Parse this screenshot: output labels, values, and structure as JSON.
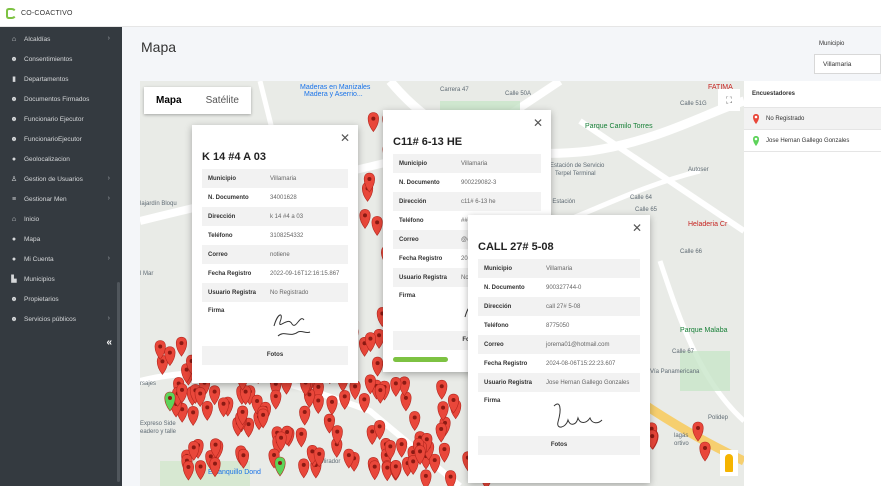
{
  "brand": {
    "name": "CO-COACTIVO"
  },
  "sidebar": {
    "items": [
      {
        "label": "Alcaldías",
        "icon": "bank-icon",
        "chevron": true
      },
      {
        "label": "Consentimientos",
        "icon": "users-icon",
        "chevron": false
      },
      {
        "label": "Departamentos",
        "icon": "building-icon",
        "chevron": false
      },
      {
        "label": "Documentos Firmados",
        "icon": "users-icon",
        "chevron": false
      },
      {
        "label": "Funcionario Ejecutor",
        "icon": "users-icon",
        "chevron": false
      },
      {
        "label": "FuncionarioEjecutor",
        "icon": "users-icon",
        "chevron": false
      },
      {
        "label": "Geolocalizacion",
        "icon": "map-marker-icon",
        "chevron": false
      },
      {
        "label": "Gestion de Usuarios",
        "icon": "user-icon",
        "chevron": true
      },
      {
        "label": "Gestionar Men",
        "icon": "list-icon",
        "chevron": true
      },
      {
        "label": "Inicio",
        "icon": "home-icon",
        "chevron": false
      },
      {
        "label": "Mapa",
        "icon": "map-marker-icon",
        "chevron": false
      },
      {
        "label": "Mi Cuenta",
        "icon": "circle-icon",
        "chevron": true
      },
      {
        "label": "Municipios",
        "icon": "industry-icon",
        "chevron": false
      },
      {
        "label": "Propietarios",
        "icon": "users-icon",
        "chevron": false
      },
      {
        "label": "Servicios públicos",
        "icon": "users-icon",
        "chevron": true
      }
    ],
    "collapse_label": "«"
  },
  "page": {
    "title": "Mapa"
  },
  "filter": {
    "label": "Municipio",
    "value": "Villamaria"
  },
  "map": {
    "type_buttons": {
      "map": "Mapa",
      "satellite": "Satélite"
    },
    "labels": [
      "Maderas en Manizales",
      "Madera y Aserrio...",
      "Carrera 47",
      "Calle 50A",
      "Calle 51G",
      "Parque Camilo Torres",
      "Estación de Servicio",
      "Terpel Terminal",
      "reo Estación",
      "Autoser",
      "Heladeria Cr",
      "Calle 64",
      "Calle 65",
      "Calle 66",
      "Parque Malaba",
      "Calle 67",
      "Vía Panamericana",
      "lajardín Bloqu",
      "l Mar",
      "rsajes",
      "Expreso Side",
      "eadero y talle",
      "Estanquillo Dond",
      "Mirador",
      "tronger Gym",
      "lagás",
      "ortivo",
      "Polidep",
      "FATIMA"
    ]
  },
  "popups": [
    {
      "title": "K 14 #4 A 03",
      "rows": [
        {
          "k": "Municipio",
          "v": "Villamaria"
        },
        {
          "k": "N. Documento",
          "v": "34001628"
        },
        {
          "k": "Dirección",
          "v": "k 14 #4 a 03"
        },
        {
          "k": "Teléfono",
          "v": "3108254332"
        },
        {
          "k": "Correo",
          "v": "notiene"
        },
        {
          "k": "Fecha Registro",
          "v": "2022-09-16T12:16:15.867"
        },
        {
          "k": "Usuario Registra",
          "v": "No Registrado"
        }
      ],
      "sig_label": "Firma",
      "fotos": "Fotos"
    },
    {
      "title": "C11# 6-13 HE",
      "rows": [
        {
          "k": "Municipio",
          "v": "Villamaria"
        },
        {
          "k": "N. Documento",
          "v": "900229082-3"
        },
        {
          "k": "Dirección",
          "v": "c11# 6-13 he"
        },
        {
          "k": "Teléfono",
          "v": "###"
        },
        {
          "k": "Correo",
          "v": "@@"
        },
        {
          "k": "Fecha Registro",
          "v": "202"
        },
        {
          "k": "Usuario Registra",
          "v": "No"
        }
      ],
      "sig_label": "Firma",
      "fotos": "Fot"
    },
    {
      "title": "CALL 27# 5-08",
      "rows": [
        {
          "k": "Municipio",
          "v": "Villamaria"
        },
        {
          "k": "N. Documento",
          "v": "900327744-0"
        },
        {
          "k": "Dirección",
          "v": "call 27# 5-08"
        },
        {
          "k": "Teléfono",
          "v": "8775050"
        },
        {
          "k": "Correo",
          "v": "jorema01@hotmail.com"
        },
        {
          "k": "Fecha Registro",
          "v": "2024-08-06T15:22:23.607"
        },
        {
          "k": "Usuario Registra",
          "v": "Jose Hernan Gallego Gonzales"
        }
      ],
      "sig_label": "Firma",
      "fotos": "Fotos"
    }
  ],
  "legend": {
    "title": "Encuestadores",
    "items": [
      {
        "label": "No Registrado",
        "color": "#e9473a"
      },
      {
        "label": "Jose Hernan Gallego Gonzales",
        "color": "#5dd35a"
      }
    ]
  },
  "colors": {
    "pin_red": "#e9473a",
    "pin_green": "#5dd35a",
    "sidebar": "#343a40"
  }
}
